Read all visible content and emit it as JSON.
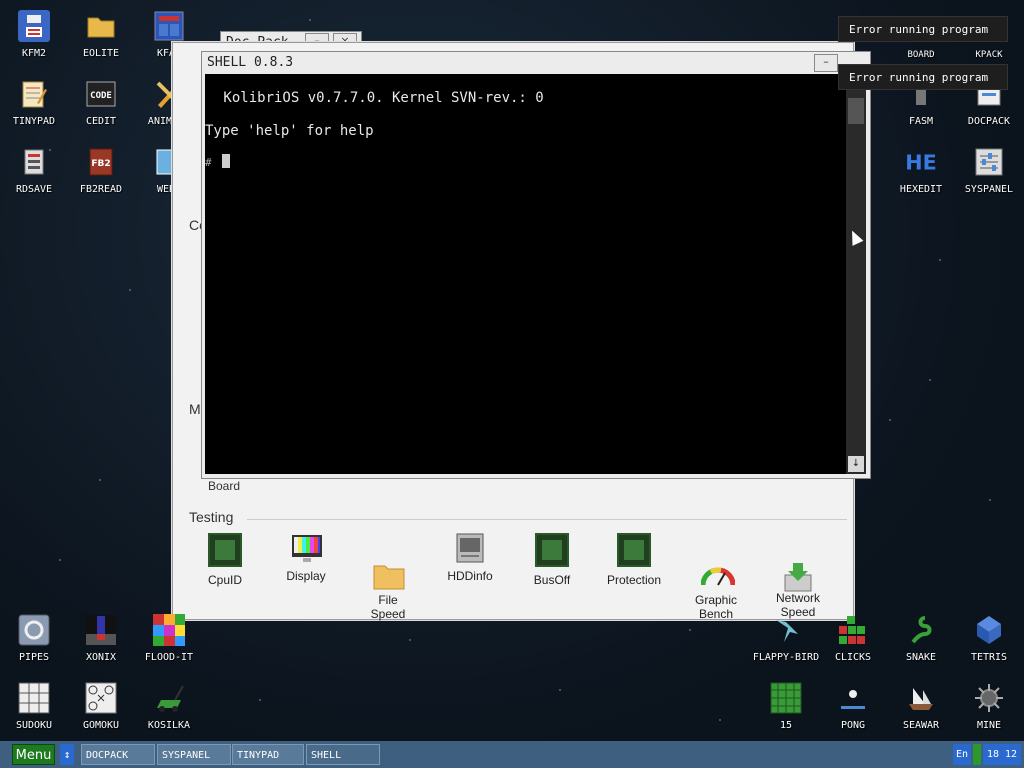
{
  "desktop": {
    "icons_left": [
      {
        "label": "KFM2",
        "icon": "floppy-icon",
        "color": "#3a66c4"
      },
      {
        "label": "EOLITE",
        "icon": "folder-icon",
        "color": "#e0b050"
      },
      {
        "label": "KFAR",
        "icon": "kfar-icon",
        "color": "#2a56b8"
      },
      {
        "label": "TINYPAD",
        "icon": "notepad-icon",
        "color": "#f0e0b0"
      },
      {
        "label": "CEDIT",
        "icon": "code-icon",
        "color": "#333"
      },
      {
        "label": "ANIMAGE",
        "icon": "pencil-icon",
        "color": "#e09030"
      },
      {
        "label": "RDSAVE",
        "icon": "rdsave-icon",
        "color": "#888"
      },
      {
        "label": "FB2READ",
        "icon": "book-icon",
        "color": "#a04030"
      },
      {
        "label": "WEBV",
        "icon": "web-icon",
        "color": "#3a8ac4"
      }
    ],
    "icons_right": [
      {
        "label": "BOARD",
        "icon": "board-icon",
        "color": "#333"
      },
      {
        "label": "KPACK",
        "icon": "kpack-icon",
        "color": "#666"
      },
      {
        "label": "FASM",
        "icon": "fasm-icon",
        "color": "#2a56b8"
      },
      {
        "label": "DOCPACK",
        "icon": "docpack-icon",
        "color": "#4a8ad0"
      },
      {
        "label": "HEXEDIT",
        "icon": "hex-icon",
        "color": "#2a6ad0"
      },
      {
        "label": "SYSPANEL",
        "icon": "panel-icon",
        "color": "#999"
      }
    ],
    "icons_bottom": [
      {
        "label": "PIPES",
        "icon": "pipes-icon",
        "color": "#8a9ab0"
      },
      {
        "label": "XONIX",
        "icon": "xonix-icon",
        "color": "#222"
      },
      {
        "label": "FLOOD-IT",
        "icon": "flood-icon",
        "color": "#c05050"
      },
      {
        "label": "SUDOKU",
        "icon": "sudoku-icon",
        "color": "#ddd"
      },
      {
        "label": "GOMOKU",
        "icon": "gomoku-icon",
        "color": "#eee"
      },
      {
        "label": "KOSILKA",
        "icon": "mower-icon",
        "color": "#3a9a3a"
      },
      {
        "label": "FLAPPY-BIRD",
        "icon": "bird-icon",
        "color": "#60b0c0"
      },
      {
        "label": "CLICKS",
        "icon": "clicks-icon",
        "color": "#3a9a3a"
      },
      {
        "label": "SNAKE",
        "icon": "snake-icon",
        "color": "#3aa03a"
      },
      {
        "label": "TETRIS",
        "icon": "tetris-icon",
        "color": "#4a7ad0"
      },
      {
        "label": "15",
        "icon": "fifteen-icon",
        "color": "#3a9a3a"
      },
      {
        "label": "PONG",
        "icon": "pong-icon",
        "color": "#ddd"
      },
      {
        "label": "SEAWAR",
        "icon": "ship-icon",
        "color": "#bbb"
      },
      {
        "label": "MINE",
        "icon": "mine-icon",
        "color": "#999"
      }
    ]
  },
  "docpack": {
    "title": "Doc Pack",
    "minimize": "–",
    "close": "×",
    "partial_text_c": "Co",
    "partial_text_m": "M",
    "board_label": "Board",
    "testing_section": "Testing",
    "tools": [
      {
        "label": "CpuID",
        "icon": "chip-icon"
      },
      {
        "label": "Display",
        "icon": "monitor-icon"
      },
      {
        "label": "File\nSpeed",
        "icon": "folder-icon"
      },
      {
        "label": "HDDinfo",
        "icon": "hdd-icon"
      },
      {
        "label": "BusOff",
        "icon": "chip-icon"
      },
      {
        "label": "Protection",
        "icon": "chip-icon"
      },
      {
        "label": "Graphic\nBench",
        "icon": "gauge-icon"
      },
      {
        "label": "Network\nSpeed",
        "icon": "download-icon"
      }
    ]
  },
  "shell": {
    "title": "SHELL 0.8.3",
    "minimize": "–",
    "lines": [
      " KolibriOS v0.7.7.0. Kernel SVN-rev.: 0",
      "Type 'help' for help",
      "#"
    ],
    "scroll_down": "↓"
  },
  "notifications": [
    {
      "text": "Error running program"
    },
    {
      "text": "Error running program"
    }
  ],
  "taskbar": {
    "menu": "Menu",
    "switch": "↕",
    "tasks": [
      "DOCPACK",
      "SYSPANEL",
      "TINYPAD",
      "SHELL"
    ],
    "lang": "En",
    "time": "18 12"
  }
}
